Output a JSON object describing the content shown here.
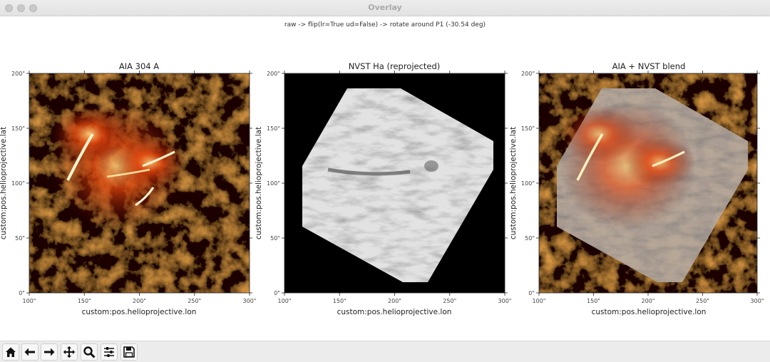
{
  "window": {
    "title": "Overlay"
  },
  "figure": {
    "suptitle": "raw -> flip(lr=True ud=False) -> rotate around P1 (-30.54 deg)"
  },
  "panels": [
    {
      "title": "AIA 304 A",
      "xlabel": "custom:pos.helioprojective.lon",
      "ylabel": "custom:pos.helioprojective.lat"
    },
    {
      "title": "NVST Ha (reprojected)",
      "xlabel": "custom:pos.helioprojective.lon",
      "ylabel": "custom:pos.helioprojective.lat"
    },
    {
      "title": "AIA + NVST blend",
      "xlabel": "custom:pos.helioprojective.lon",
      "ylabel": "custom:pos.helioprojective.lat"
    }
  ],
  "axes": {
    "xticks": [
      "100\"",
      "150\"",
      "200\"",
      "250\"",
      "300\""
    ],
    "yticks": [
      "0\"",
      "50\"",
      "100\"",
      "150\"",
      "200\""
    ],
    "xlim": [
      100,
      300
    ],
    "ylim": [
      0,
      200
    ]
  },
  "colors": {
    "aia_dark": "#1a0000",
    "aia_hot": "#ff7a1a",
    "nvst_light": "#e2e2e2",
    "background": "#000000"
  },
  "toolbar": {
    "buttons": [
      {
        "name": "home-button",
        "icon": "home-icon"
      },
      {
        "name": "back-button",
        "icon": "arrow-left-icon"
      },
      {
        "name": "forward-button",
        "icon": "arrow-right-icon"
      },
      {
        "name": "pan-button",
        "icon": "move-icon"
      },
      {
        "name": "zoom-button",
        "icon": "magnifier-icon"
      },
      {
        "name": "configure-subplots-button",
        "icon": "sliders-icon"
      },
      {
        "name": "save-button",
        "icon": "floppy-icon"
      }
    ]
  }
}
